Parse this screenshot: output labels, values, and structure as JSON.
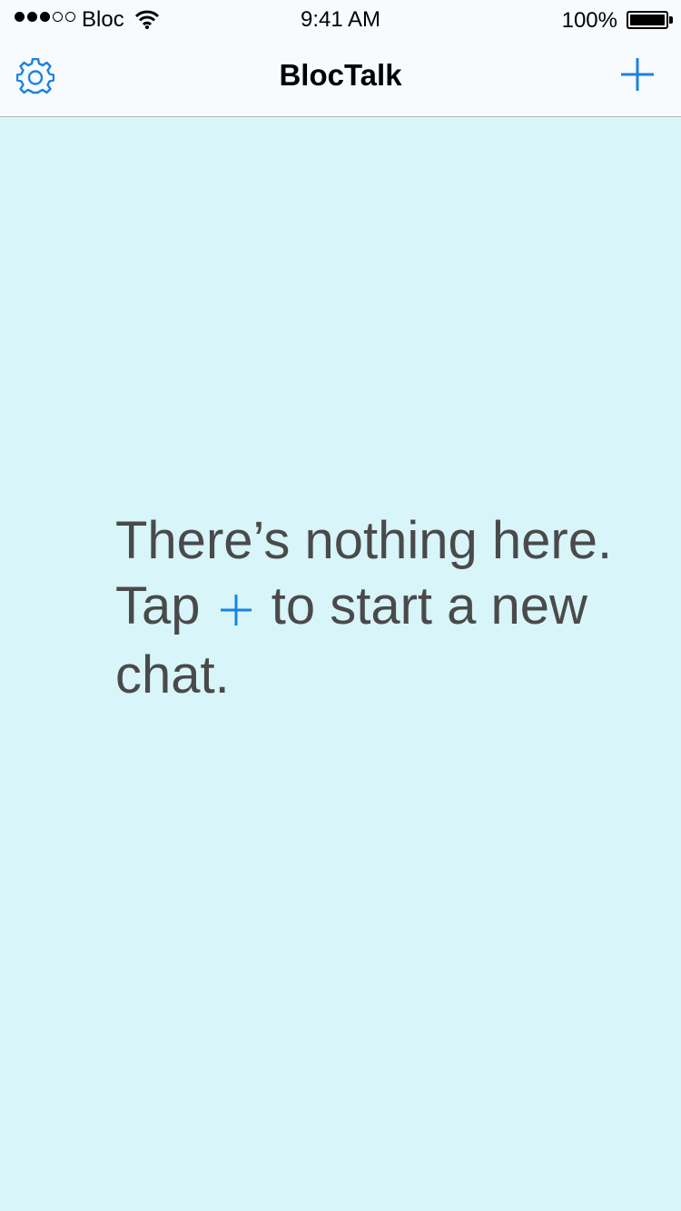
{
  "status_bar": {
    "carrier": "Bloc",
    "time": "9:41 AM",
    "battery": "100%",
    "signal_bars_filled": 3,
    "signal_bars_total": 5
  },
  "nav": {
    "title": "BlocTalk",
    "left_icon": "gear-icon",
    "right_icon": "plus-icon"
  },
  "empty_state": {
    "line_part1": "There’s nothing here. Tap",
    "line_part2": "to start a new chat."
  },
  "colors": {
    "accent": "#1a82e2",
    "background": "#d8f5f9",
    "bar_background": "#f7fbfd",
    "message_text": "#4a4a4a"
  }
}
